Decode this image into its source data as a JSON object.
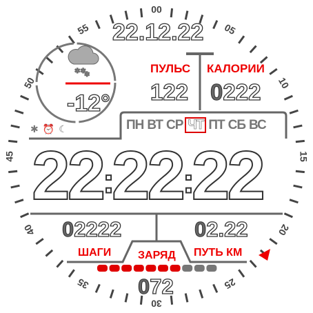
{
  "dial": {
    "labels": [
      "00",
      "05",
      "10",
      "15",
      "20",
      "25",
      "30",
      "35",
      "40",
      "45",
      "50",
      "55"
    ]
  },
  "date": "22.12.22",
  "weather": {
    "icon": "snow-cloud-icon",
    "temperature": "-12°"
  },
  "pulse": {
    "label": "ПУЛЬС",
    "value": "122"
  },
  "calories": {
    "label": "КАЛОРИИ",
    "lead": "0",
    "value": "222"
  },
  "weekdays": [
    {
      "label": "ПН"
    },
    {
      "label": "ВТ"
    },
    {
      "label": "СР"
    },
    {
      "label": "ЧТ",
      "active": true
    },
    {
      "label": "ПТ"
    },
    {
      "label": "СБ"
    },
    {
      "label": "ВС"
    }
  ],
  "status_icons": [
    "bluetooth-icon",
    "alarm-icon",
    "moon-icon"
  ],
  "time": {
    "hours": "22",
    "minutes": "22",
    "seconds": "22"
  },
  "steps": {
    "label": "ШАГИ",
    "lead": "0",
    "value": "2222"
  },
  "distance": {
    "label": "ПУТЬ КМ",
    "lead": "0",
    "value": "2.22"
  },
  "battery": {
    "label": "ЗАРЯД",
    "lead": "0",
    "value": "72",
    "segments_total": 10,
    "segments_filled": 7
  },
  "colors": {
    "accent": "#e00000",
    "gray": "#666666"
  }
}
